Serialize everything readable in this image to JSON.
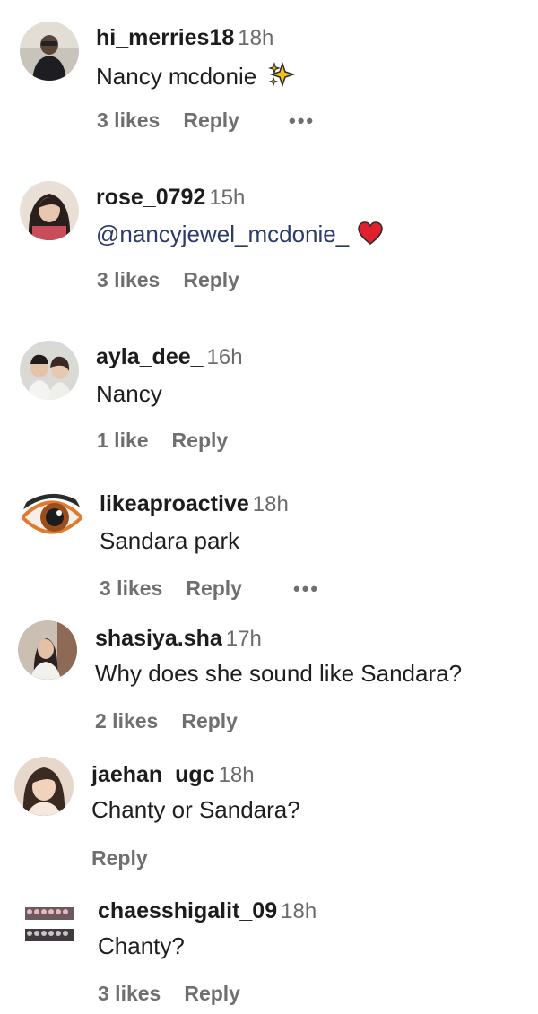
{
  "comments": [
    {
      "username": "hi_merries18",
      "time": "18h",
      "text": "Nancy mcdonie",
      "emoji": "sparkles-icon",
      "likes": "3 likes",
      "reply": "Reply",
      "more": "•••"
    },
    {
      "username": "rose_0792",
      "time": "15h",
      "text": "@nancyjewel_mcdonie_",
      "emoji": "red-heart-icon",
      "likes": "3 likes",
      "reply": "Reply"
    },
    {
      "username": "ayla_dee_",
      "time": "16h",
      "text": "Nancy",
      "likes": "1 like",
      "reply": "Reply"
    },
    {
      "username": "likeaproactive",
      "time": "18h",
      "text": "Sandara park",
      "likes": "3 likes",
      "reply": "Reply",
      "more": "•••"
    },
    {
      "username": "shasiya.sha",
      "time": "17h",
      "text": "Why does she sound like Sandara?",
      "likes": "2 likes",
      "reply": "Reply"
    },
    {
      "username": "jaehan_ugc",
      "time": "18h",
      "text": "Chanty or Sandara?",
      "reply": "Reply"
    },
    {
      "username": "chaesshigalit_09",
      "time": "18h",
      "text": "Chanty?",
      "likes": "3 likes",
      "reply": "Reply"
    }
  ],
  "colors": {
    "username": "#1c1c1c",
    "meta": "#6f6f6f",
    "mention": "#2d3b6b",
    "heart": "#e0202e",
    "sparkle": "#f4c21a"
  }
}
